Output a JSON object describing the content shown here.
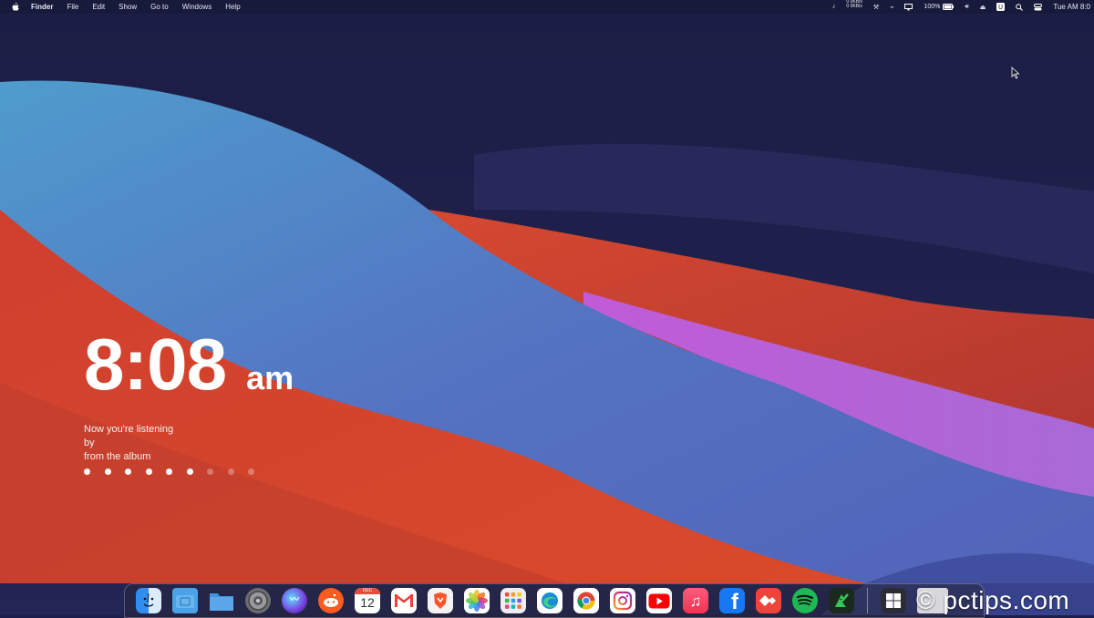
{
  "menubar": {
    "app_name": "Finder",
    "items": [
      "File",
      "Edit",
      "Show",
      "Go to",
      "Windows",
      "Help"
    ],
    "status": {
      "net_up": "0 0KB/s",
      "net_down": "0 0KB/s",
      "battery": "100%",
      "clock": "Tue AM 8:0"
    }
  },
  "clock_widget": {
    "time": "8:08",
    "ampm": "am",
    "now_playing": [
      "Now you're listening",
      "by",
      "from the album"
    ],
    "dots_total": 9,
    "dots_active": 6
  },
  "dock": {
    "apps": [
      {
        "icon": "finder-icon",
        "color": "#3b9cf0"
      },
      {
        "icon": "screenshot-folder-icon",
        "color": "#4aa3e6"
      },
      {
        "icon": "folder-icon",
        "color": "#3f8fd8"
      },
      {
        "icon": "system-preferences-icon",
        "color": "#8a8a8a"
      },
      {
        "icon": "siri-icon",
        "color": "#6a4cd8"
      },
      {
        "icon": "reddit-icon",
        "color": "#ff5a1f"
      },
      {
        "icon": "calendar-icon",
        "color": "#ffffff",
        "label": "12",
        "month": "DEC"
      },
      {
        "icon": "gmail-icon",
        "color": "#ffffff"
      },
      {
        "icon": "brave-icon",
        "color": "#f9f9f9"
      },
      {
        "icon": "photos-icon",
        "color": "#ffffff"
      },
      {
        "icon": "launchpad-icon",
        "color": "#e9e9ee"
      },
      {
        "icon": "edge-icon",
        "color": "#ffffff"
      },
      {
        "icon": "chrome-icon",
        "color": "#ffffff"
      },
      {
        "icon": "instagram-icon",
        "color": "#ffffff"
      },
      {
        "icon": "youtube-icon",
        "color": "#ffffff"
      },
      {
        "icon": "music-icon",
        "color": "#fb3352"
      },
      {
        "icon": "facebook-icon",
        "color": "#1877f2"
      },
      {
        "icon": "anydesk-icon",
        "color": "#ef443b"
      },
      {
        "icon": "spotify-icon",
        "color": "#1db954"
      },
      {
        "icon": "xmind-icon",
        "color": "#1b2a1e"
      }
    ],
    "extra": [
      {
        "icon": "windows-icon",
        "color": "#2c2c34"
      },
      {
        "icon": "window-thumbnail-icon",
        "color": "#d8d8dc"
      }
    ]
  },
  "watermark": "© pctips.com"
}
